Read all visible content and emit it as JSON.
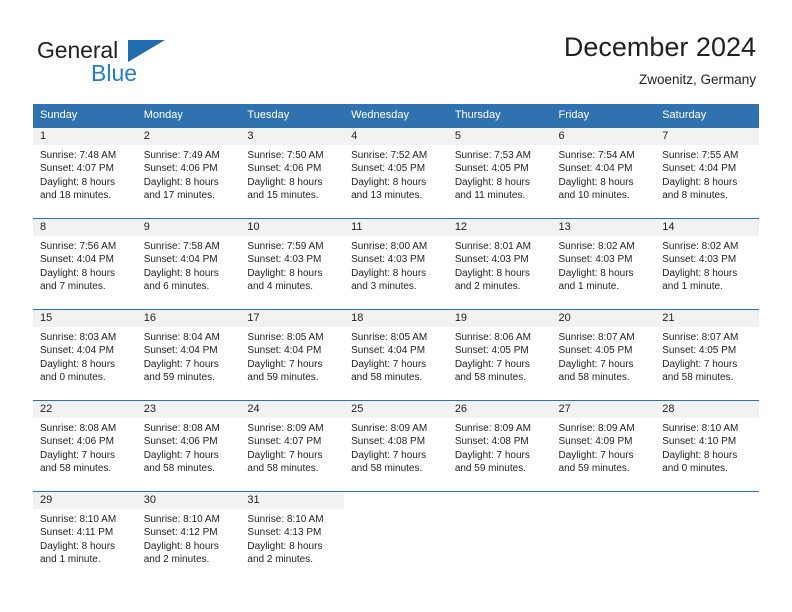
{
  "brand": {
    "name_part1": "General",
    "name_part2": "Blue",
    "triangle_icon": "triangle-logo-icon",
    "color_dark": "#231f20",
    "color_blue": "#1f7fd4",
    "triangle_color": "#1f6cb0"
  },
  "header": {
    "title": "December 2024",
    "subtitle": "Zwoenitz, Germany"
  },
  "theme": {
    "header_bg": "#3072b0",
    "header_text": "#ffffff",
    "daynum_bg": "#f2f2f2",
    "rule_color": "#3072b0",
    "body_text": "#231f20"
  },
  "weekdays": [
    "Sunday",
    "Monday",
    "Tuesday",
    "Wednesday",
    "Thursday",
    "Friday",
    "Saturday"
  ],
  "weeks": [
    [
      {
        "day": "1",
        "sunrise": "Sunrise: 7:48 AM",
        "sunset": "Sunset: 4:07 PM",
        "daylight1": "Daylight: 8 hours",
        "daylight2": "and 18 minutes."
      },
      {
        "day": "2",
        "sunrise": "Sunrise: 7:49 AM",
        "sunset": "Sunset: 4:06 PM",
        "daylight1": "Daylight: 8 hours",
        "daylight2": "and 17 minutes."
      },
      {
        "day": "3",
        "sunrise": "Sunrise: 7:50 AM",
        "sunset": "Sunset: 4:06 PM",
        "daylight1": "Daylight: 8 hours",
        "daylight2": "and 15 minutes."
      },
      {
        "day": "4",
        "sunrise": "Sunrise: 7:52 AM",
        "sunset": "Sunset: 4:05 PM",
        "daylight1": "Daylight: 8 hours",
        "daylight2": "and 13 minutes."
      },
      {
        "day": "5",
        "sunrise": "Sunrise: 7:53 AM",
        "sunset": "Sunset: 4:05 PM",
        "daylight1": "Daylight: 8 hours",
        "daylight2": "and 11 minutes."
      },
      {
        "day": "6",
        "sunrise": "Sunrise: 7:54 AM",
        "sunset": "Sunset: 4:04 PM",
        "daylight1": "Daylight: 8 hours",
        "daylight2": "and 10 minutes."
      },
      {
        "day": "7",
        "sunrise": "Sunrise: 7:55 AM",
        "sunset": "Sunset: 4:04 PM",
        "daylight1": "Daylight: 8 hours",
        "daylight2": "and 8 minutes."
      }
    ],
    [
      {
        "day": "8",
        "sunrise": "Sunrise: 7:56 AM",
        "sunset": "Sunset: 4:04 PM",
        "daylight1": "Daylight: 8 hours",
        "daylight2": "and 7 minutes."
      },
      {
        "day": "9",
        "sunrise": "Sunrise: 7:58 AM",
        "sunset": "Sunset: 4:04 PM",
        "daylight1": "Daylight: 8 hours",
        "daylight2": "and 6 minutes."
      },
      {
        "day": "10",
        "sunrise": "Sunrise: 7:59 AM",
        "sunset": "Sunset: 4:03 PM",
        "daylight1": "Daylight: 8 hours",
        "daylight2": "and 4 minutes."
      },
      {
        "day": "11",
        "sunrise": "Sunrise: 8:00 AM",
        "sunset": "Sunset: 4:03 PM",
        "daylight1": "Daylight: 8 hours",
        "daylight2": "and 3 minutes."
      },
      {
        "day": "12",
        "sunrise": "Sunrise: 8:01 AM",
        "sunset": "Sunset: 4:03 PM",
        "daylight1": "Daylight: 8 hours",
        "daylight2": "and 2 minutes."
      },
      {
        "day": "13",
        "sunrise": "Sunrise: 8:02 AM",
        "sunset": "Sunset: 4:03 PM",
        "daylight1": "Daylight: 8 hours",
        "daylight2": "and 1 minute."
      },
      {
        "day": "14",
        "sunrise": "Sunrise: 8:02 AM",
        "sunset": "Sunset: 4:03 PM",
        "daylight1": "Daylight: 8 hours",
        "daylight2": "and 1 minute."
      }
    ],
    [
      {
        "day": "15",
        "sunrise": "Sunrise: 8:03 AM",
        "sunset": "Sunset: 4:04 PM",
        "daylight1": "Daylight: 8 hours",
        "daylight2": "and 0 minutes."
      },
      {
        "day": "16",
        "sunrise": "Sunrise: 8:04 AM",
        "sunset": "Sunset: 4:04 PM",
        "daylight1": "Daylight: 7 hours",
        "daylight2": "and 59 minutes."
      },
      {
        "day": "17",
        "sunrise": "Sunrise: 8:05 AM",
        "sunset": "Sunset: 4:04 PM",
        "daylight1": "Daylight: 7 hours",
        "daylight2": "and 59 minutes."
      },
      {
        "day": "18",
        "sunrise": "Sunrise: 8:05 AM",
        "sunset": "Sunset: 4:04 PM",
        "daylight1": "Daylight: 7 hours",
        "daylight2": "and 58 minutes."
      },
      {
        "day": "19",
        "sunrise": "Sunrise: 8:06 AM",
        "sunset": "Sunset: 4:05 PM",
        "daylight1": "Daylight: 7 hours",
        "daylight2": "and 58 minutes."
      },
      {
        "day": "20",
        "sunrise": "Sunrise: 8:07 AM",
        "sunset": "Sunset: 4:05 PM",
        "daylight1": "Daylight: 7 hours",
        "daylight2": "and 58 minutes."
      },
      {
        "day": "21",
        "sunrise": "Sunrise: 8:07 AM",
        "sunset": "Sunset: 4:05 PM",
        "daylight1": "Daylight: 7 hours",
        "daylight2": "and 58 minutes."
      }
    ],
    [
      {
        "day": "22",
        "sunrise": "Sunrise: 8:08 AM",
        "sunset": "Sunset: 4:06 PM",
        "daylight1": "Daylight: 7 hours",
        "daylight2": "and 58 minutes."
      },
      {
        "day": "23",
        "sunrise": "Sunrise: 8:08 AM",
        "sunset": "Sunset: 4:06 PM",
        "daylight1": "Daylight: 7 hours",
        "daylight2": "and 58 minutes."
      },
      {
        "day": "24",
        "sunrise": "Sunrise: 8:09 AM",
        "sunset": "Sunset: 4:07 PM",
        "daylight1": "Daylight: 7 hours",
        "daylight2": "and 58 minutes."
      },
      {
        "day": "25",
        "sunrise": "Sunrise: 8:09 AM",
        "sunset": "Sunset: 4:08 PM",
        "daylight1": "Daylight: 7 hours",
        "daylight2": "and 58 minutes."
      },
      {
        "day": "26",
        "sunrise": "Sunrise: 8:09 AM",
        "sunset": "Sunset: 4:08 PM",
        "daylight1": "Daylight: 7 hours",
        "daylight2": "and 59 minutes."
      },
      {
        "day": "27",
        "sunrise": "Sunrise: 8:09 AM",
        "sunset": "Sunset: 4:09 PM",
        "daylight1": "Daylight: 7 hours",
        "daylight2": "and 59 minutes."
      },
      {
        "day": "28",
        "sunrise": "Sunrise: 8:10 AM",
        "sunset": "Sunset: 4:10 PM",
        "daylight1": "Daylight: 8 hours",
        "daylight2": "and 0 minutes."
      }
    ],
    [
      {
        "day": "29",
        "sunrise": "Sunrise: 8:10 AM",
        "sunset": "Sunset: 4:11 PM",
        "daylight1": "Daylight: 8 hours",
        "daylight2": "and 1 minute."
      },
      {
        "day": "30",
        "sunrise": "Sunrise: 8:10 AM",
        "sunset": "Sunset: 4:12 PM",
        "daylight1": "Daylight: 8 hours",
        "daylight2": "and 2 minutes."
      },
      {
        "day": "31",
        "sunrise": "Sunrise: 8:10 AM",
        "sunset": "Sunset: 4:13 PM",
        "daylight1": "Daylight: 8 hours",
        "daylight2": "and 2 minutes."
      },
      {
        "day": "",
        "sunrise": "",
        "sunset": "",
        "daylight1": "",
        "daylight2": ""
      },
      {
        "day": "",
        "sunrise": "",
        "sunset": "",
        "daylight1": "",
        "daylight2": ""
      },
      {
        "day": "",
        "sunrise": "",
        "sunset": "",
        "daylight1": "",
        "daylight2": ""
      },
      {
        "day": "",
        "sunrise": "",
        "sunset": "",
        "daylight1": "",
        "daylight2": ""
      }
    ]
  ]
}
